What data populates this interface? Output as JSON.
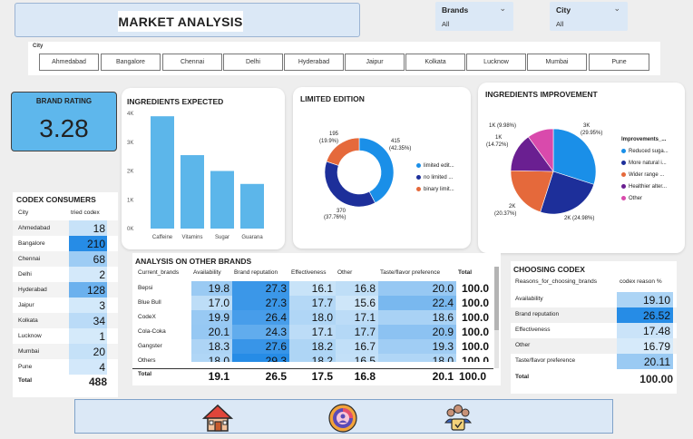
{
  "header": {
    "title": "MARKET ANALYSIS"
  },
  "slicers": {
    "brands": {
      "label": "Brands",
      "value": "All"
    },
    "city": {
      "label": "City",
      "value": "All"
    }
  },
  "city_slicer": {
    "label": "City",
    "items": [
      "Ahmedabad",
      "Bangalore",
      "Chennai",
      "Delhi",
      "Hyderabad",
      "Jaipur",
      "Kolkata",
      "Lucknow",
      "Mumbai",
      "Pune"
    ]
  },
  "brand_rating": {
    "label": "BRAND RATING",
    "value": "3.28"
  },
  "codex_consumers": {
    "title": "CODEX CONSUMERS",
    "col_city": "City",
    "col_tried": "tried codex",
    "rows": [
      {
        "city": "Ahmedabad",
        "value": 18
      },
      {
        "city": "Bangalore",
        "value": 210
      },
      {
        "city": "Chennai",
        "value": 68
      },
      {
        "city": "Delhi",
        "value": 2
      },
      {
        "city": "Hyderabad",
        "value": 128
      },
      {
        "city": "Jaipur",
        "value": 3
      },
      {
        "city": "Kolkata",
        "value": 34
      },
      {
        "city": "Lucknow",
        "value": 1
      },
      {
        "city": "Mumbai",
        "value": 20
      },
      {
        "city": "Pune",
        "value": 4
      }
    ],
    "total_label": "Total",
    "total": "488"
  },
  "ingredients_expected": {
    "title": "INGREDIENTS EXPECTED",
    "yticks": [
      "4K",
      "3K",
      "2K",
      "1K",
      "0K"
    ],
    "colors": {
      "bar": "#5cb6ea"
    }
  },
  "limited_edition": {
    "title": "LIMITED EDITION",
    "labels": {
      "top_left": "195",
      "top_left_pct": "(19.9%)",
      "right": "415",
      "right_pct": "(42.35%)",
      "bottom": "370",
      "bottom_pct": "(37.76%)"
    },
    "legend": [
      "limited edit...",
      "no limited ...",
      "binary limit..."
    ],
    "colors": [
      "#1a8fe8",
      "#1d2f9a",
      "#e5693b"
    ]
  },
  "ingredients_improvement": {
    "title": "INGREDIENTS IMPROVEMENT",
    "legend_title": "Improvements_...",
    "legend": [
      "Reduced suga...",
      "More natural i...",
      "Wider range ...",
      "Healthier alter...",
      "Other"
    ],
    "labels": {
      "l1": "1K (9.98%)",
      "l2": "1K",
      "l2b": "(14.72%)",
      "r1": "3K",
      "r1b": "(29.95%)",
      "l3": "2K",
      "l3b": "(20.37%)",
      "b1": "2K (24.98%)"
    },
    "colors": [
      "#1a8fe8",
      "#1d2f9a",
      "#e5693b",
      "#6a1f91",
      "#d94aac"
    ]
  },
  "analysis_other_brands": {
    "title": "ANALYSIS ON OTHER BRANDS",
    "columns": [
      "Current_brands",
      "Availability",
      "Brand reputation",
      "Effectiveness",
      "Other",
      "Taste/flavor preference",
      "Total"
    ],
    "rows": [
      {
        "brand": "Bepsi",
        "vals": [
          "19.8",
          "27.3",
          "16.1",
          "16.8",
          "20.0"
        ],
        "total": "100.0"
      },
      {
        "brand": "Blue Bull",
        "vals": [
          "17.0",
          "27.3",
          "17.7",
          "15.6",
          "22.4"
        ],
        "total": "100.0"
      },
      {
        "brand": "CodeX",
        "vals": [
          "19.9",
          "26.4",
          "18.0",
          "17.1",
          "18.6"
        ],
        "total": "100.0"
      },
      {
        "brand": "Cola-Coka",
        "vals": [
          "20.1",
          "24.3",
          "17.1",
          "17.7",
          "20.9"
        ],
        "total": "100.0"
      },
      {
        "brand": "Gangster",
        "vals": [
          "18.3",
          "27.6",
          "18.2",
          "16.7",
          "19.3"
        ],
        "total": "100.0"
      },
      {
        "brand": "Others",
        "vals": [
          "18.0",
          "29.3",
          "18.2",
          "16.5",
          "18.0"
        ],
        "total": "100.0"
      }
    ],
    "total_label": "Total",
    "totals": [
      "19.1",
      "26.5",
      "17.5",
      "16.8",
      "20.1",
      "100.0"
    ]
  },
  "choosing_codex": {
    "title": "CHOOSING CODEX",
    "col_reason": "Reasons_for_choosing_brands",
    "col_pct": "codex reason %",
    "rows": [
      {
        "reason": "Availability",
        "value": "19.10"
      },
      {
        "reason": "Brand reputation",
        "value": "26.52"
      },
      {
        "reason": "Effectiveness",
        "value": "17.48"
      },
      {
        "reason": "Other",
        "value": "16.79"
      },
      {
        "reason": "Taste/flavor preference",
        "value": "20.11"
      }
    ],
    "total_label": "Total",
    "total": "100.00"
  },
  "nav": {
    "icons": [
      "home-icon",
      "analytics-icon",
      "team-icon"
    ]
  },
  "chart_data": [
    {
      "type": "bar",
      "title": "INGREDIENTS EXPECTED",
      "categories": [
        "Caffeine",
        "Vitamins",
        "Sugar",
        "Guarana"
      ],
      "values": [
        3.9,
        2.55,
        2.0,
        1.55
      ],
      "yunit": "K",
      "ylim": [
        0,
        4
      ]
    },
    {
      "type": "pie",
      "title": "LIMITED EDITION",
      "labels": [
        "limited edit...",
        "no limited ...",
        "binary limit..."
      ],
      "values": [
        415,
        370,
        195
      ]
    },
    {
      "type": "pie",
      "title": "INGREDIENTS IMPROVEMENT",
      "labels": [
        "Reduced suga...",
        "More natural i...",
        "Wider range ...",
        "Healthier alter...",
        "Other"
      ],
      "values": [
        29.95,
        24.98,
        20.37,
        14.72,
        9.98
      ]
    }
  ]
}
